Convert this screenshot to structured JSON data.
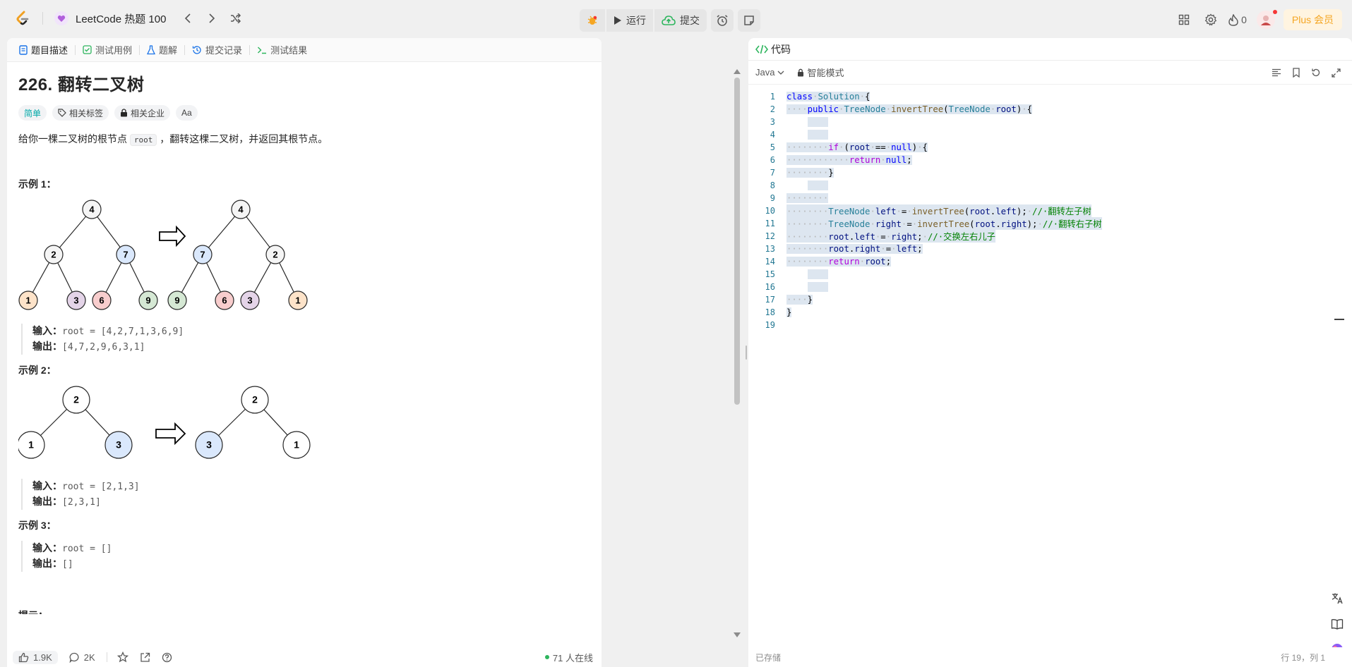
{
  "topbar": {
    "list_title": "LeetCode 热题 100",
    "run_label": "运行",
    "submit_label": "提交",
    "fire_count": "0",
    "plus_label": "Plus 会员"
  },
  "tabs": [
    {
      "label": "题目描述",
      "icon": "description-icon"
    },
    {
      "label": "测试用例",
      "icon": "checkbox-icon"
    },
    {
      "label": "题解",
      "icon": "flask-icon"
    },
    {
      "label": "提交记录",
      "icon": "history-icon"
    },
    {
      "label": "测试结果",
      "icon": "terminal-icon"
    }
  ],
  "problem": {
    "title": "226. 翻转二叉树",
    "tags": {
      "difficulty": "简单",
      "related_tags": "相关标签",
      "related_companies": "相关企业",
      "font": "Aa"
    },
    "desc_pre": "给你一棵二叉树的根节点 ",
    "desc_code": "root",
    "desc_post": " ，翻转这棵二叉树，并返回其根节点。",
    "input_label": "输入：",
    "output_label": "输出：",
    "examples": [
      {
        "title": "示例 1：",
        "input": "root = [4,2,7,1,3,6,9]",
        "output": "[4,7,2,9,6,3,1]"
      },
      {
        "title": "示例 2：",
        "input": "root = [2,1,3]",
        "output": "[2,3,1]"
      },
      {
        "title": "示例 3：",
        "input": "root = []",
        "output": "[]"
      }
    ],
    "hint_label": "提示："
  },
  "trees": {
    "ex1_before": {
      "root": "4",
      "l": "2",
      "r": "7",
      "ll": "1",
      "lr": "3",
      "rl": "6",
      "rr": "9"
    },
    "ex1_after": {
      "root": "4",
      "l": "7",
      "r": "2",
      "ll": "9",
      "lr": "6",
      "rl": "3",
      "rr": "1"
    },
    "ex2_before": {
      "root": "2",
      "l": "1",
      "r": "3"
    },
    "ex2_after": {
      "root": "2",
      "l": "3",
      "r": "1"
    }
  },
  "colors": {
    "orange": "#fde3c9",
    "purple": "#e4d4e8",
    "red": "#f8cdcd",
    "green": "#d5e8d4",
    "blue": "#dae8fc",
    "grey": "#f5f5f5"
  },
  "left_footer": {
    "likes": "1.9K",
    "comments": "2K",
    "online": "71 人在线"
  },
  "editor": {
    "panel_title": "代码",
    "language": "Java",
    "mode": "智能模式",
    "saved": "已存储",
    "position": "行 19，列 1",
    "lines": [
      "1",
      "2",
      "3",
      "4",
      "5",
      "6",
      "7",
      "8",
      "9",
      "10",
      "11",
      "12",
      "13",
      "14",
      "15",
      "16",
      "17",
      "18",
      "19"
    ]
  }
}
